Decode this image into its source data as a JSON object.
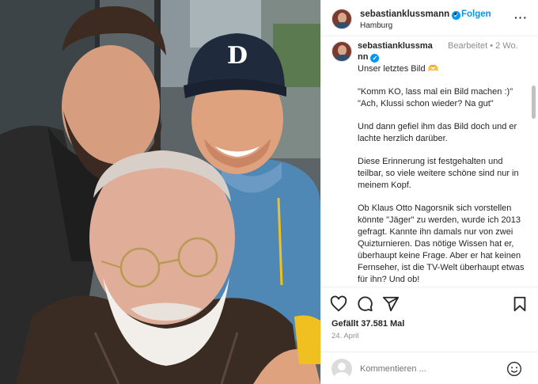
{
  "photo": {
    "alt_icon": "selfie-photo"
  },
  "header": {
    "username": "sebastianklussmann",
    "separator": "•",
    "follow_label": "Folgen",
    "location": "Hamburg",
    "more_icon": "more-options-icon",
    "more_label": "···"
  },
  "caption": {
    "username": "sebastianklussmann",
    "edited_label": "Bearbeitet",
    "time_ago": "• 2 Wo.",
    "paragraphs": [
      "Unser letztes Bild 🫶",
      "\"Komm KO, lass mal ein Bild machen :)\" \"Ach, Klussi schon wieder? Na gut\"",
      "Und dann gefiel ihm das Bild doch und er lachte herzlich darüber.",
      "Diese Erinnerung ist festgehalten und teilbar, so viele weitere schöne sind nur in meinem Kopf.",
      "Ob Klaus Otto Nagorsnik sich vorstellen könnte \"Jäger\" zu werden, wurde ich 2013 gefragt. Kannte ihn damals nur von zwei Quizturnieren. Das nötige Wissen hat er, überhaupt keine Frage. Aber er hat keinen Fernseher, ist die TV-Welt überhaupt etwas für ihn? Und ob!"
    ]
  },
  "actions": {
    "like_icon": "heart-icon",
    "comment_icon": "comment-icon",
    "share_icon": "share-icon",
    "save_icon": "bookmark-icon",
    "likes_text": "Gefällt 37.581 Mal",
    "date": "24. April"
  },
  "comment": {
    "placeholder": "Kommentieren ...",
    "emoji_icon": "emoji-icon"
  },
  "colors": {
    "accent": "#0095f6",
    "text": "#262626",
    "muted": "#8e8e8e",
    "border": "#efefef"
  }
}
